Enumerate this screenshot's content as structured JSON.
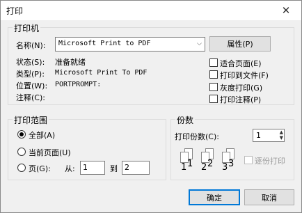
{
  "window": {
    "title": "打印",
    "close_glyph": "✕"
  },
  "printer": {
    "group_title": "打印机",
    "name_label": "名称(N):",
    "selected_printer": "Microsoft Print to PDF",
    "properties_button": "属性(P)",
    "status_label": "状态(S):",
    "status_value": "准备就绪",
    "type_label": "类型(P):",
    "type_value": "Microsoft Print To PDF",
    "where_label": "位置(W):",
    "where_value": "PORTPROMPT:",
    "comment_label": "注释(C):",
    "comment_value": "",
    "options": [
      {
        "label": "适合页面(E)",
        "checked": false
      },
      {
        "label": "打印到文件(F)",
        "checked": false
      },
      {
        "label": "灰度打印(G)",
        "checked": false
      },
      {
        "label": "打印注释(P)",
        "checked": false
      }
    ]
  },
  "range": {
    "group_title": "打印范围",
    "all_label": "全部(A)",
    "current_label": "当前页面(U)",
    "pages_label": "页(G):",
    "from_label": "从:",
    "from_value": "1",
    "to_label": "到",
    "to_value": "2",
    "selected": "all"
  },
  "copies": {
    "group_title": "份数",
    "copies_label": "打印份数(C):",
    "copies_value": "1",
    "collate_label": "逐份打印",
    "collate_checked": false,
    "collate_enabled": false,
    "icon_numbers": [
      "1",
      "1",
      "2",
      "2",
      "3",
      "3"
    ]
  },
  "buttons": {
    "ok": "确定",
    "cancel": "取消"
  },
  "colors": {
    "accent": "#0078d7",
    "window_bg": "#f0f0f0",
    "border": "#dcdcdc"
  }
}
